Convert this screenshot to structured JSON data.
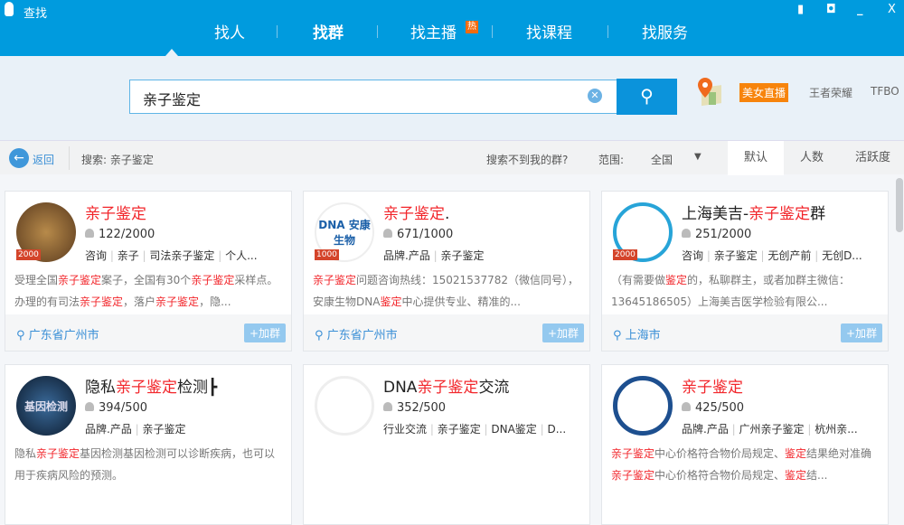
{
  "window": {
    "title": "查找",
    "controls": [
      "feedback",
      "skin",
      "minimize",
      "close"
    ],
    "close_label": "X",
    "min_label": "_"
  },
  "nav": {
    "tabs": [
      {
        "label": "找人"
      },
      {
        "label": "找群",
        "active": true
      },
      {
        "label": "找主播",
        "badge": "热"
      },
      {
        "label": "找课程"
      },
      {
        "label": "找服务"
      }
    ]
  },
  "search": {
    "value": "亲子鉴定",
    "clear_icon": "clear-icon",
    "button_icon": "search-icon"
  },
  "quick_links": {
    "hot": "美女直播",
    "links": [
      "王者荣耀",
      "TFBO"
    ]
  },
  "filter": {
    "back": "返回",
    "query": "搜索: 亲子鉴定",
    "not_found": "搜索不到我的群?",
    "scope_label": "范围:",
    "scope_value": "全国",
    "sort_tabs": [
      "默认",
      "人数",
      "活跃度"
    ],
    "active_sort": "默认"
  },
  "colors": {
    "brand": "#009bde",
    "highlight": "#f2262b",
    "hot": "#f7840c"
  },
  "add_label": "+加群",
  "cards": [
    {
      "title": [
        [
          "亲子鉴定",
          1
        ]
      ],
      "level": "2000",
      "avatar": "",
      "members": "122/2000",
      "tags": [
        "咨询",
        "亲子",
        "司法亲子鉴定",
        "个人..."
      ],
      "desc": [
        [
          "受理全国",
          0
        ],
        [
          "亲子鉴定",
          1
        ],
        [
          "案子，全国有30个",
          0
        ],
        [
          "亲子鉴定",
          1
        ],
        [
          "采样点。办理的有司法",
          0
        ],
        [
          "亲子鉴定",
          1
        ],
        [
          "，落户",
          0
        ],
        [
          "亲子鉴定",
          1
        ],
        [
          "，隐...",
          0
        ]
      ],
      "location": "广东省广州市"
    },
    {
      "title": [
        [
          "亲子鉴定",
          1
        ],
        [
          ".",
          0
        ]
      ],
      "level": "1000",
      "avatar": "DNA 安康生物",
      "members": "671/1000",
      "tags": [
        "品牌.产品",
        "亲子鉴定"
      ],
      "desc": [
        [
          "亲子鉴定",
          1
        ],
        [
          "问题咨询热线：15021537782（微信同号），安康生物DNA",
          0
        ],
        [
          "鉴定",
          1
        ],
        [
          "中心提供专业、精准的...",
          0
        ]
      ],
      "location": "广东省广州市"
    },
    {
      "title": [
        [
          "上海美吉-",
          0
        ],
        [
          "亲子鉴定",
          1
        ],
        [
          "群",
          0
        ]
      ],
      "level": "2000",
      "avatar": "",
      "members": "251/2000",
      "tags": [
        "咨询",
        "亲子鉴定",
        "无创产前",
        "无创D..."
      ],
      "desc": [
        [
          "（有需要做",
          0
        ],
        [
          "鉴定",
          1
        ],
        [
          "的，私聊群主，或者加群主微信：13645186505）上海美吉医学检验有限公...",
          0
        ]
      ],
      "location": "上海市"
    },
    {
      "title": [
        [
          "隐私",
          0
        ],
        [
          "亲子鉴定",
          1
        ],
        [
          "检测┣",
          0
        ]
      ],
      "level": "",
      "avatar": "基因检测",
      "members": "394/500",
      "tags": [
        "品牌.产品",
        "亲子鉴定"
      ],
      "desc": [
        [
          "隐私",
          0
        ],
        [
          "亲子鉴定",
          1
        ],
        [
          "基因检测基因检测可以诊断疾病，也可以用于疾病风险的预测。",
          0
        ]
      ],
      "location": ""
    },
    {
      "title": [
        [
          "DNA",
          0
        ],
        [
          "亲子鉴定",
          1
        ],
        [
          "交流",
          0
        ]
      ],
      "level": "",
      "avatar": "",
      "members": "352/500",
      "tags": [
        "行业交流",
        "亲子鉴定",
        "DNA鉴定",
        "D..."
      ],
      "desc": [],
      "location": ""
    },
    {
      "title": [
        [
          "亲子鉴定",
          1
        ]
      ],
      "level": "",
      "avatar": "",
      "members": "425/500",
      "tags": [
        "品牌.产品",
        "广州亲子鉴定",
        "杭州亲..."
      ],
      "desc": [
        [
          "亲子鉴定",
          1
        ],
        [
          "中心价格符合物价局规定、",
          0
        ],
        [
          "鉴定",
          1
        ],
        [
          "结果绝对准确",
          0
        ],
        [
          "亲子鉴定",
          1
        ],
        [
          "中心价格符合物价局规定、",
          0
        ],
        [
          "鉴定",
          1
        ],
        [
          "结...",
          0
        ]
      ],
      "location": ""
    }
  ]
}
